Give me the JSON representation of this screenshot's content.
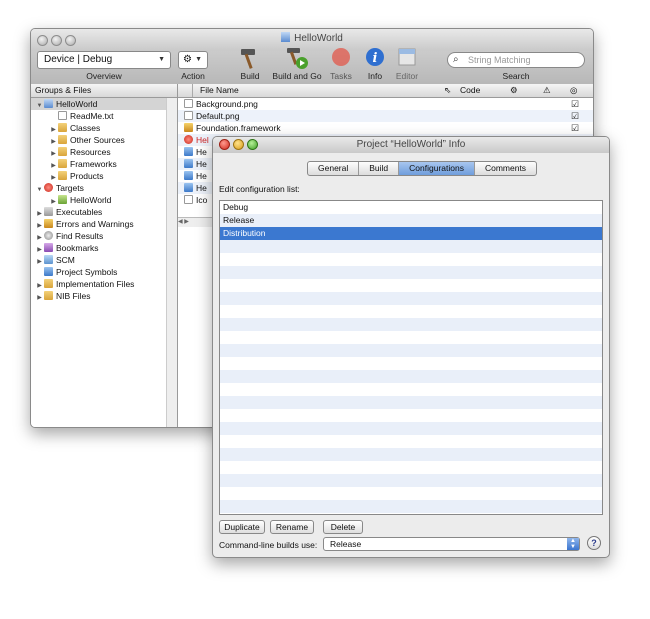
{
  "main_window": {
    "title": "HelloWorld",
    "toolbar": {
      "overview_value": "Device | Debug",
      "overview_label": "Overview",
      "action_label": "Action",
      "build_label": "Build",
      "build_and_go_label": "Build and Go",
      "tasks_label": "Tasks",
      "info_label": "Info",
      "editor_label": "Editor",
      "search_placeholder": "String Matching",
      "search_label": "Search"
    },
    "groups_header": "Groups & Files",
    "tree": [
      {
        "label": "HelloWorld",
        "icon": "project-icon"
      },
      {
        "label": "ReadMe.txt",
        "icon": "document-icon"
      },
      {
        "label": "Classes",
        "icon": "folder-icon"
      },
      {
        "label": "Other Sources",
        "icon": "folder-icon"
      },
      {
        "label": "Resources",
        "icon": "folder-icon"
      },
      {
        "label": "Frameworks",
        "icon": "folder-icon"
      },
      {
        "label": "Products",
        "icon": "folder-icon"
      },
      {
        "label": "Targets",
        "icon": "target-icon"
      },
      {
        "label": "HelloWorld",
        "icon": "app-target-icon"
      },
      {
        "label": "Executables",
        "icon": "executable-icon"
      },
      {
        "label": "Errors and Warnings",
        "icon": "warning-icon"
      },
      {
        "label": "Find Results",
        "icon": "magnifier-icon"
      },
      {
        "label": "Bookmarks",
        "icon": "bookmark-icon"
      },
      {
        "label": "SCM",
        "icon": "scm-icon"
      },
      {
        "label": "Project Symbols",
        "icon": "symbols-icon"
      },
      {
        "label": "Implementation Files",
        "icon": "folder-icon"
      },
      {
        "label": "NIB Files",
        "icon": "folder-icon"
      }
    ],
    "file_columns": {
      "name": "File Name",
      "code": "Code"
    },
    "files": [
      "Background.png",
      "Default.png",
      "Foundation.framework",
      "Hel",
      "He",
      "He",
      "He",
      "He",
      "Ico"
    ]
  },
  "info_window": {
    "title": "Project “HelloWorld” Info",
    "tabs": [
      "General",
      "Build",
      "Configurations",
      "Comments"
    ],
    "selected_tab": "Configurations",
    "list_label": "Edit configuration list:",
    "configurations": [
      "Debug",
      "Release",
      "Distribution"
    ],
    "selected_configuration": "Distribution",
    "buttons": {
      "duplicate": "Duplicate",
      "rename": "Rename",
      "delete": "Delete"
    },
    "cmdline_label": "Command-line builds use:",
    "cmdline_value": "Release",
    "help": "?"
  }
}
